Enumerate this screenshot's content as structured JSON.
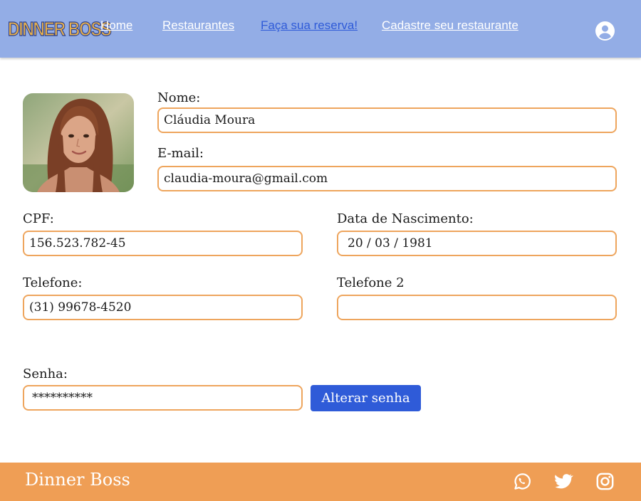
{
  "header": {
    "logo": "DINNER BOSS",
    "nav": [
      {
        "label": "Home",
        "active": false
      },
      {
        "label": "Restaurantes",
        "active": false
      },
      {
        "label": "Faça sua reserva!",
        "active": true
      },
      {
        "label": "Cadastre seu restaurante",
        "active": false
      }
    ],
    "user_icon": "user-circle-icon"
  },
  "profile": {
    "name_label": "Nome:",
    "name_value": "Cláudia Moura",
    "email_label": "E-mail:",
    "email_value": "claudia-moura@gmail.com",
    "cpf_label": "CPF:",
    "cpf_value": "156.523.782-45",
    "birth_label": "Data de Nascimento:",
    "birth_value": "20 / 03 / 1981",
    "phone_label": "Telefone:",
    "phone_value": "(31) 99678-4520",
    "phone2_label": "Telefone 2",
    "phone2_value": "",
    "password_label": "Senha:",
    "password_value": "**********",
    "change_password_label": "Alterar senha"
  },
  "footer": {
    "brand": "Dinner Boss",
    "social_icons": [
      "whatsapp-icon",
      "twitter-icon",
      "instagram-icon"
    ]
  },
  "colors": {
    "header_bg": "#93ade6",
    "active_link": "#2f5bd8",
    "field_border": "#eea55d",
    "button_bg": "#2f5bd8",
    "footer_bg": "#ef9e55"
  }
}
